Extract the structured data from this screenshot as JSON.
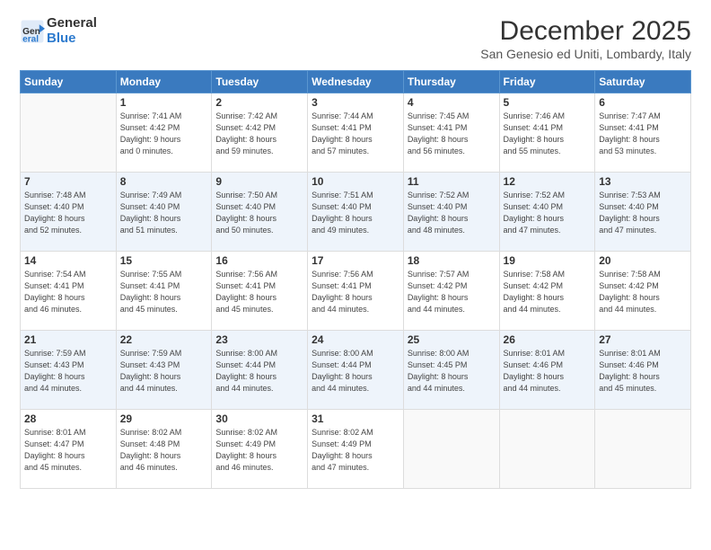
{
  "header": {
    "logo": {
      "general": "General",
      "blue": "Blue"
    },
    "title": "December 2025",
    "location": "San Genesio ed Uniti, Lombardy, Italy"
  },
  "calendar": {
    "weekdays": [
      "Sunday",
      "Monday",
      "Tuesday",
      "Wednesday",
      "Thursday",
      "Friday",
      "Saturday"
    ],
    "rows": [
      [
        {
          "day": "",
          "info": ""
        },
        {
          "day": "1",
          "info": "Sunrise: 7:41 AM\nSunset: 4:42 PM\nDaylight: 9 hours\nand 0 minutes."
        },
        {
          "day": "2",
          "info": "Sunrise: 7:42 AM\nSunset: 4:42 PM\nDaylight: 8 hours\nand 59 minutes."
        },
        {
          "day": "3",
          "info": "Sunrise: 7:44 AM\nSunset: 4:41 PM\nDaylight: 8 hours\nand 57 minutes."
        },
        {
          "day": "4",
          "info": "Sunrise: 7:45 AM\nSunset: 4:41 PM\nDaylight: 8 hours\nand 56 minutes."
        },
        {
          "day": "5",
          "info": "Sunrise: 7:46 AM\nSunset: 4:41 PM\nDaylight: 8 hours\nand 55 minutes."
        },
        {
          "day": "6",
          "info": "Sunrise: 7:47 AM\nSunset: 4:41 PM\nDaylight: 8 hours\nand 53 minutes."
        }
      ],
      [
        {
          "day": "7",
          "info": "Sunrise: 7:48 AM\nSunset: 4:40 PM\nDaylight: 8 hours\nand 52 minutes."
        },
        {
          "day": "8",
          "info": "Sunrise: 7:49 AM\nSunset: 4:40 PM\nDaylight: 8 hours\nand 51 minutes."
        },
        {
          "day": "9",
          "info": "Sunrise: 7:50 AM\nSunset: 4:40 PM\nDaylight: 8 hours\nand 50 minutes."
        },
        {
          "day": "10",
          "info": "Sunrise: 7:51 AM\nSunset: 4:40 PM\nDaylight: 8 hours\nand 49 minutes."
        },
        {
          "day": "11",
          "info": "Sunrise: 7:52 AM\nSunset: 4:40 PM\nDaylight: 8 hours\nand 48 minutes."
        },
        {
          "day": "12",
          "info": "Sunrise: 7:52 AM\nSunset: 4:40 PM\nDaylight: 8 hours\nand 47 minutes."
        },
        {
          "day": "13",
          "info": "Sunrise: 7:53 AM\nSunset: 4:40 PM\nDaylight: 8 hours\nand 47 minutes."
        }
      ],
      [
        {
          "day": "14",
          "info": "Sunrise: 7:54 AM\nSunset: 4:41 PM\nDaylight: 8 hours\nand 46 minutes."
        },
        {
          "day": "15",
          "info": "Sunrise: 7:55 AM\nSunset: 4:41 PM\nDaylight: 8 hours\nand 45 minutes."
        },
        {
          "day": "16",
          "info": "Sunrise: 7:56 AM\nSunset: 4:41 PM\nDaylight: 8 hours\nand 45 minutes."
        },
        {
          "day": "17",
          "info": "Sunrise: 7:56 AM\nSunset: 4:41 PM\nDaylight: 8 hours\nand 44 minutes."
        },
        {
          "day": "18",
          "info": "Sunrise: 7:57 AM\nSunset: 4:42 PM\nDaylight: 8 hours\nand 44 minutes."
        },
        {
          "day": "19",
          "info": "Sunrise: 7:58 AM\nSunset: 4:42 PM\nDaylight: 8 hours\nand 44 minutes."
        },
        {
          "day": "20",
          "info": "Sunrise: 7:58 AM\nSunset: 4:42 PM\nDaylight: 8 hours\nand 44 minutes."
        }
      ],
      [
        {
          "day": "21",
          "info": "Sunrise: 7:59 AM\nSunset: 4:43 PM\nDaylight: 8 hours\nand 44 minutes."
        },
        {
          "day": "22",
          "info": "Sunrise: 7:59 AM\nSunset: 4:43 PM\nDaylight: 8 hours\nand 44 minutes."
        },
        {
          "day": "23",
          "info": "Sunrise: 8:00 AM\nSunset: 4:44 PM\nDaylight: 8 hours\nand 44 minutes."
        },
        {
          "day": "24",
          "info": "Sunrise: 8:00 AM\nSunset: 4:44 PM\nDaylight: 8 hours\nand 44 minutes."
        },
        {
          "day": "25",
          "info": "Sunrise: 8:00 AM\nSunset: 4:45 PM\nDaylight: 8 hours\nand 44 minutes."
        },
        {
          "day": "26",
          "info": "Sunrise: 8:01 AM\nSunset: 4:46 PM\nDaylight: 8 hours\nand 44 minutes."
        },
        {
          "day": "27",
          "info": "Sunrise: 8:01 AM\nSunset: 4:46 PM\nDaylight: 8 hours\nand 45 minutes."
        }
      ],
      [
        {
          "day": "28",
          "info": "Sunrise: 8:01 AM\nSunset: 4:47 PM\nDaylight: 8 hours\nand 45 minutes."
        },
        {
          "day": "29",
          "info": "Sunrise: 8:02 AM\nSunset: 4:48 PM\nDaylight: 8 hours\nand 46 minutes."
        },
        {
          "day": "30",
          "info": "Sunrise: 8:02 AM\nSunset: 4:49 PM\nDaylight: 8 hours\nand 46 minutes."
        },
        {
          "day": "31",
          "info": "Sunrise: 8:02 AM\nSunset: 4:49 PM\nDaylight: 8 hours\nand 47 minutes."
        },
        {
          "day": "",
          "info": ""
        },
        {
          "day": "",
          "info": ""
        },
        {
          "day": "",
          "info": ""
        }
      ]
    ]
  }
}
